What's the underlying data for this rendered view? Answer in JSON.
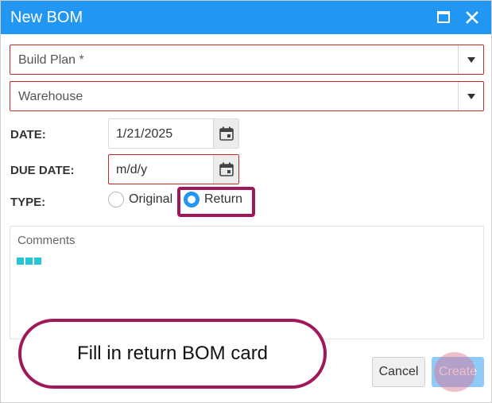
{
  "dialog": {
    "title": "New BOM",
    "maximize_icon": "maximize-icon",
    "close_icon": "close-icon"
  },
  "form": {
    "build_plan": {
      "placeholder": "Build Plan *"
    },
    "warehouse": {
      "value": "Warehouse"
    },
    "date": {
      "label": "DATE:",
      "value": "1/21/2025",
      "icon": "calendar-icon"
    },
    "due_date": {
      "label": "DUE DATE:",
      "placeholder": "m/d/y",
      "icon": "calendar-icon"
    },
    "type": {
      "label": "TYPE:",
      "options": [
        {
          "label": "Original",
          "checked": false
        },
        {
          "label": "Return",
          "checked": true
        }
      ]
    },
    "comments": {
      "placeholder": "Comments"
    }
  },
  "buttons": {
    "cancel": "Cancel",
    "create": "Create"
  },
  "annotation": {
    "callout_text": "Fill in return BOM card"
  },
  "colors": {
    "accent": "#2196f3",
    "error_border": "#c62828",
    "highlight": "#a0185a",
    "loader": "#26c6da",
    "create_disabled": "#90caf9"
  }
}
